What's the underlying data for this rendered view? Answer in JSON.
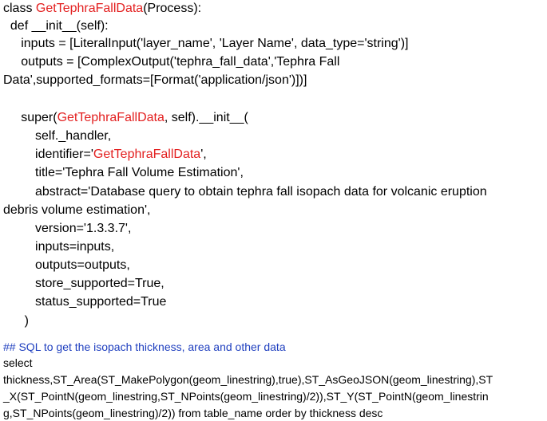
{
  "colors": {
    "text": "#000000",
    "highlight": "#e32020",
    "comment": "#1f3fbf",
    "background": "#ffffff"
  },
  "code": {
    "l1_a": "class ",
    "l1_b": "GetTephraFallData",
    "l1_c": "(Process):",
    "l2": "  def __init__(self):",
    "l3": "     inputs = [LiteralInput('layer_name', 'Layer Name', data_type='string')]",
    "l4": "     outputs = [ComplexOutput('tephra_fall_data','Tephra Fall",
    "l5": "Data',supported_formats=[Format('application/json')])]",
    "l7_a": "     super(",
    "l7_b": "GetTephraFallData",
    "l7_c": ", self).__init__(",
    "l8": "         self._handler,",
    "l9_a": "         identifier='",
    "l9_b": "GetTephraFallData",
    "l9_c": "',",
    "l10": "         title='Tephra Fall Volume Estimation',",
    "l11": "         abstract='Database query to obtain tephra fall isopach data for volcanic eruption",
    "l12": "debris volume estimation',",
    "l13": "         version='1.3.3.7',",
    "l14": "         inputs=inputs,",
    "l15": "         outputs=outputs,",
    "l16": "         store_supported=True,",
    "l17": "         status_supported=True",
    "l18": "      )"
  },
  "sql": {
    "comment": "## SQL to get the isopach thickness, area and other data",
    "l1": "select",
    "l2": "thickness,ST_Area(ST_MakePolygon(geom_linestring),true),ST_AsGeoJSON(geom_linestring),ST",
    "l3": "_X(ST_PointN(geom_linestring,ST_NPoints(geom_linestring)/2)),ST_Y(ST_PointN(geom_linestrin",
    "l4": "g,ST_NPoints(geom_linestring)/2)) from table_name order by thickness desc"
  }
}
